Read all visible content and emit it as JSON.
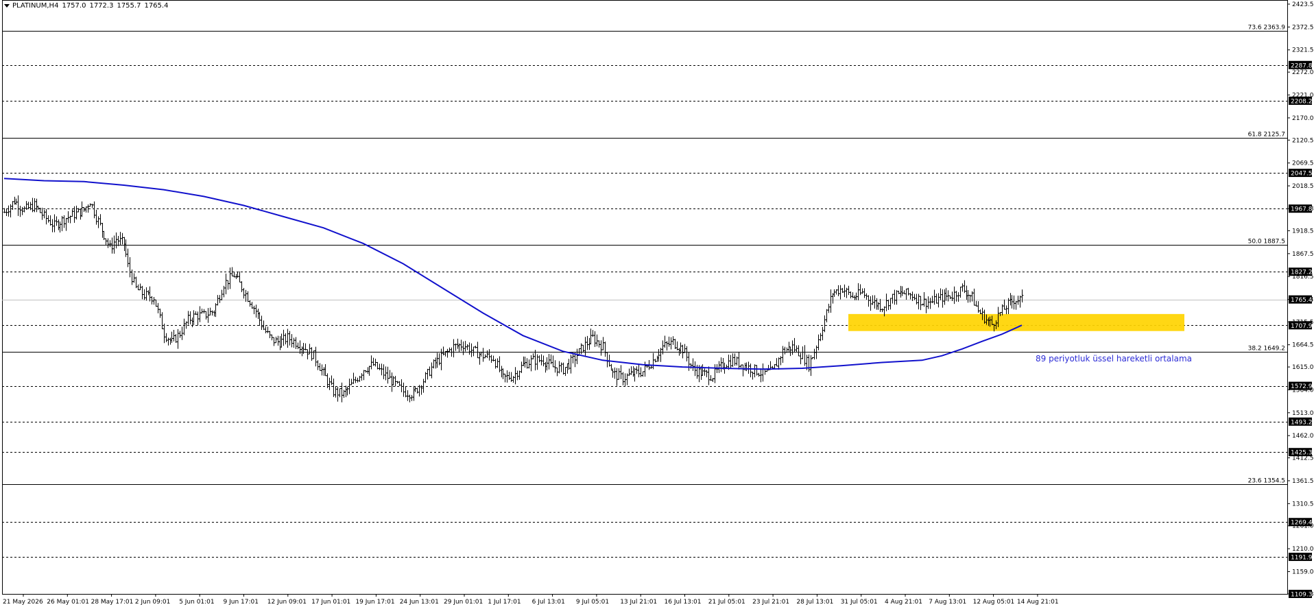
{
  "header": {
    "symbol": "PLATINUM,H4",
    "open": "1757.0",
    "high": "1772.3",
    "low": "1755.7",
    "close": "1765.4"
  },
  "annotation": "89 periyotluk üssel hareketli ortalama",
  "colors": {
    "bull_bear_bars": "#000000",
    "ema": "#1111cc",
    "zone": "#ffd400",
    "annotation": "#2b2bd6",
    "grid": "#000000"
  },
  "chart_data": {
    "type": "ohlc",
    "y_range": [
      1109.3,
      2423.5
    ],
    "y_ticks": [
      "2423.5",
      "2372.5",
      "2321.5",
      "2272.0",
      "2221.0",
      "2170.0",
      "2120.5",
      "2069.5",
      "2018.5",
      "1967.8",
      "1918.5",
      "1867.5",
      "1816.5",
      "1765.4",
      "1715.5",
      "1664.5",
      "1615.0",
      "1564.0",
      "1513.0",
      "1462.0",
      "1412.5",
      "1361.5",
      "1310.5",
      "1261.0",
      "1210.0",
      "1159.0",
      "1109.3"
    ],
    "x_labels": [
      "21 May 2026",
      "26 May 01:01",
      "28 May 17:01",
      "2 Jun 09:01",
      "5 Jun 01:01",
      "9 Jun 17:01",
      "12 Jun 09:01",
      "17 Jun 01:01",
      "19 Jun 17:01",
      "24 Jun 13:01",
      "29 Jun 01:01",
      "1 Jul 17:01",
      "6 Jul 13:01",
      "9 Jul 05:01",
      "13 Jul 21:01",
      "16 Jul 13:01",
      "21 Jul 05:01",
      "23 Jul 21:01",
      "28 Jul 13:01",
      "31 Jul 05:01",
      "4 Aug 21:01",
      "7 Aug 13:01",
      "12 Aug 05:01",
      "14 Aug 21:01"
    ],
    "horizontal_levels": [
      {
        "value": 2287.8,
        "style": "dashed",
        "label": "2287.8",
        "boxed": true
      },
      {
        "value": 2208.2,
        "style": "dashed",
        "label": "2208.2",
        "boxed": true
      },
      {
        "value": 2047.5,
        "style": "dashed",
        "label": "2047.5",
        "boxed": true
      },
      {
        "value": 1967.8,
        "style": "dashed",
        "label": "1967.8",
        "boxed": true
      },
      {
        "value": 1827.2,
        "style": "dashed",
        "label": "1827.2",
        "boxed": true
      },
      {
        "value": 1707.9,
        "style": "dashed",
        "label": "1707.9",
        "boxed": true
      },
      {
        "value": 1572.9,
        "style": "dashed",
        "label": "1572.9",
        "boxed": true
      },
      {
        "value": 1493.2,
        "style": "dashed",
        "label": "1493.2",
        "boxed": true
      },
      {
        "value": 1425.3,
        "style": "dashed",
        "label": "1425.3",
        "boxed": true
      },
      {
        "value": 1269.4,
        "style": "dashed",
        "label": "1269.4",
        "boxed": true
      },
      {
        "value": 1191.9,
        "style": "dashed",
        "label": "1191.9",
        "boxed": true
      },
      {
        "value": 1109.3,
        "style": "none",
        "label": "1109.3",
        "boxed": true
      },
      {
        "value": 1765.4,
        "style": "price",
        "label": "1765.4",
        "boxed": true
      }
    ],
    "fibonacci": [
      {
        "label": "73.6 2363.9",
        "value": 2363.9
      },
      {
        "label": "61.8 2125.7",
        "value": 2125.7
      },
      {
        "label": "50.0 1887.5",
        "value": 1887.5
      },
      {
        "label": "38.2 1649.2",
        "value": 1649.2
      },
      {
        "label": "23.6 1354.5",
        "value": 1354.5
      }
    ],
    "zone": {
      "from": 1695,
      "to": 1733
    },
    "ema_period": 89,
    "ema_path": [
      [
        0,
        2035
      ],
      [
        20,
        2030
      ],
      [
        40,
        2028
      ],
      [
        60,
        2020
      ],
      [
        80,
        2010
      ],
      [
        100,
        1995
      ],
      [
        120,
        1975
      ],
      [
        140,
        1950
      ],
      [
        160,
        1925
      ],
      [
        180,
        1890
      ],
      [
        200,
        1845
      ],
      [
        220,
        1790
      ],
      [
        240,
        1735
      ],
      [
        260,
        1685
      ],
      [
        280,
        1650
      ],
      [
        300,
        1630
      ],
      [
        320,
        1620
      ],
      [
        340,
        1615
      ],
      [
        360,
        1612
      ],
      [
        380,
        1610
      ],
      [
        400,
        1612
      ],
      [
        420,
        1618
      ],
      [
        440,
        1625
      ],
      [
        460,
        1630
      ],
      [
        470,
        1640
      ],
      [
        480,
        1655
      ],
      [
        490,
        1672
      ],
      [
        500,
        1688
      ],
      [
        505,
        1698
      ],
      [
        510,
        1708
      ]
    ],
    "price_path": [
      [
        0,
        1960
      ],
      [
        5,
        1985
      ],
      [
        10,
        1965
      ],
      [
        15,
        1975
      ],
      [
        20,
        1950
      ],
      [
        25,
        1930
      ],
      [
        30,
        1945
      ],
      [
        35,
        1955
      ],
      [
        40,
        1965
      ],
      [
        43,
        1985
      ],
      [
        46,
        1950
      ],
      [
        50,
        1910
      ],
      [
        53,
        1880
      ],
      [
        56,
        1900
      ],
      [
        60,
        1890
      ],
      [
        62,
        1840
      ],
      [
        66,
        1790
      ],
      [
        70,
        1775
      ],
      [
        75,
        1770
      ],
      [
        80,
        1690
      ],
      [
        84,
        1670
      ],
      [
        88,
        1690
      ],
      [
        92,
        1720
      ],
      [
        96,
        1730
      ],
      [
        100,
        1730
      ],
      [
        105,
        1740
      ],
      [
        110,
        1800
      ],
      [
        115,
        1820
      ],
      [
        118,
        1800
      ],
      [
        122,
        1770
      ],
      [
        126,
        1740
      ],
      [
        130,
        1700
      ],
      [
        134,
        1675
      ],
      [
        138,
        1670
      ],
      [
        142,
        1680
      ],
      [
        146,
        1670
      ],
      [
        150,
        1660
      ],
      [
        155,
        1640
      ],
      [
        160,
        1600
      ],
      [
        165,
        1560
      ],
      [
        170,
        1555
      ],
      [
        175,
        1580
      ],
      [
        180,
        1610
      ],
      [
        185,
        1620
      ],
      [
        190,
        1600
      ],
      [
        195,
        1580
      ],
      [
        200,
        1560
      ],
      [
        205,
        1555
      ],
      [
        210,
        1585
      ],
      [
        215,
        1620
      ],
      [
        220,
        1640
      ],
      [
        225,
        1660
      ],
      [
        230,
        1665
      ],
      [
        235,
        1650
      ],
      [
        240,
        1640
      ],
      [
        245,
        1635
      ],
      [
        250,
        1590
      ],
      [
        255,
        1595
      ],
      [
        260,
        1620
      ],
      [
        265,
        1630
      ],
      [
        270,
        1630
      ],
      [
        275,
        1615
      ],
      [
        280,
        1610
      ],
      [
        285,
        1630
      ],
      [
        290,
        1660
      ],
      [
        295,
        1680
      ],
      [
        300,
        1660
      ],
      [
        305,
        1600
      ],
      [
        310,
        1590
      ],
      [
        315,
        1600
      ],
      [
        320,
        1605
      ],
      [
        325,
        1630
      ],
      [
        330,
        1660
      ],
      [
        335,
        1670
      ],
      [
        340,
        1655
      ],
      [
        345,
        1610
      ],
      [
        350,
        1600
      ],
      [
        355,
        1595
      ],
      [
        360,
        1620
      ],
      [
        365,
        1630
      ],
      [
        370,
        1620
      ],
      [
        375,
        1610
      ],
      [
        380,
        1600
      ],
      [
        385,
        1605
      ],
      [
        390,
        1650
      ],
      [
        395,
        1660
      ],
      [
        400,
        1640
      ],
      [
        403,
        1620
      ],
      [
        406,
        1650
      ],
      [
        410,
        1705
      ],
      [
        415,
        1780
      ],
      [
        420,
        1790
      ],
      [
        425,
        1770
      ],
      [
        430,
        1780
      ],
      [
        435,
        1760
      ],
      [
        440,
        1750
      ],
      [
        445,
        1770
      ],
      [
        450,
        1780
      ],
      [
        455,
        1775
      ],
      [
        460,
        1760
      ],
      [
        465,
        1760
      ],
      [
        470,
        1770
      ],
      [
        475,
        1775
      ],
      [
        480,
        1790
      ],
      [
        485,
        1770
      ],
      [
        488,
        1740
      ],
      [
        492,
        1720
      ],
      [
        495,
        1710
      ],
      [
        498,
        1730
      ],
      [
        502,
        1750
      ],
      [
        506,
        1765
      ],
      [
        510,
        1765
      ]
    ]
  }
}
